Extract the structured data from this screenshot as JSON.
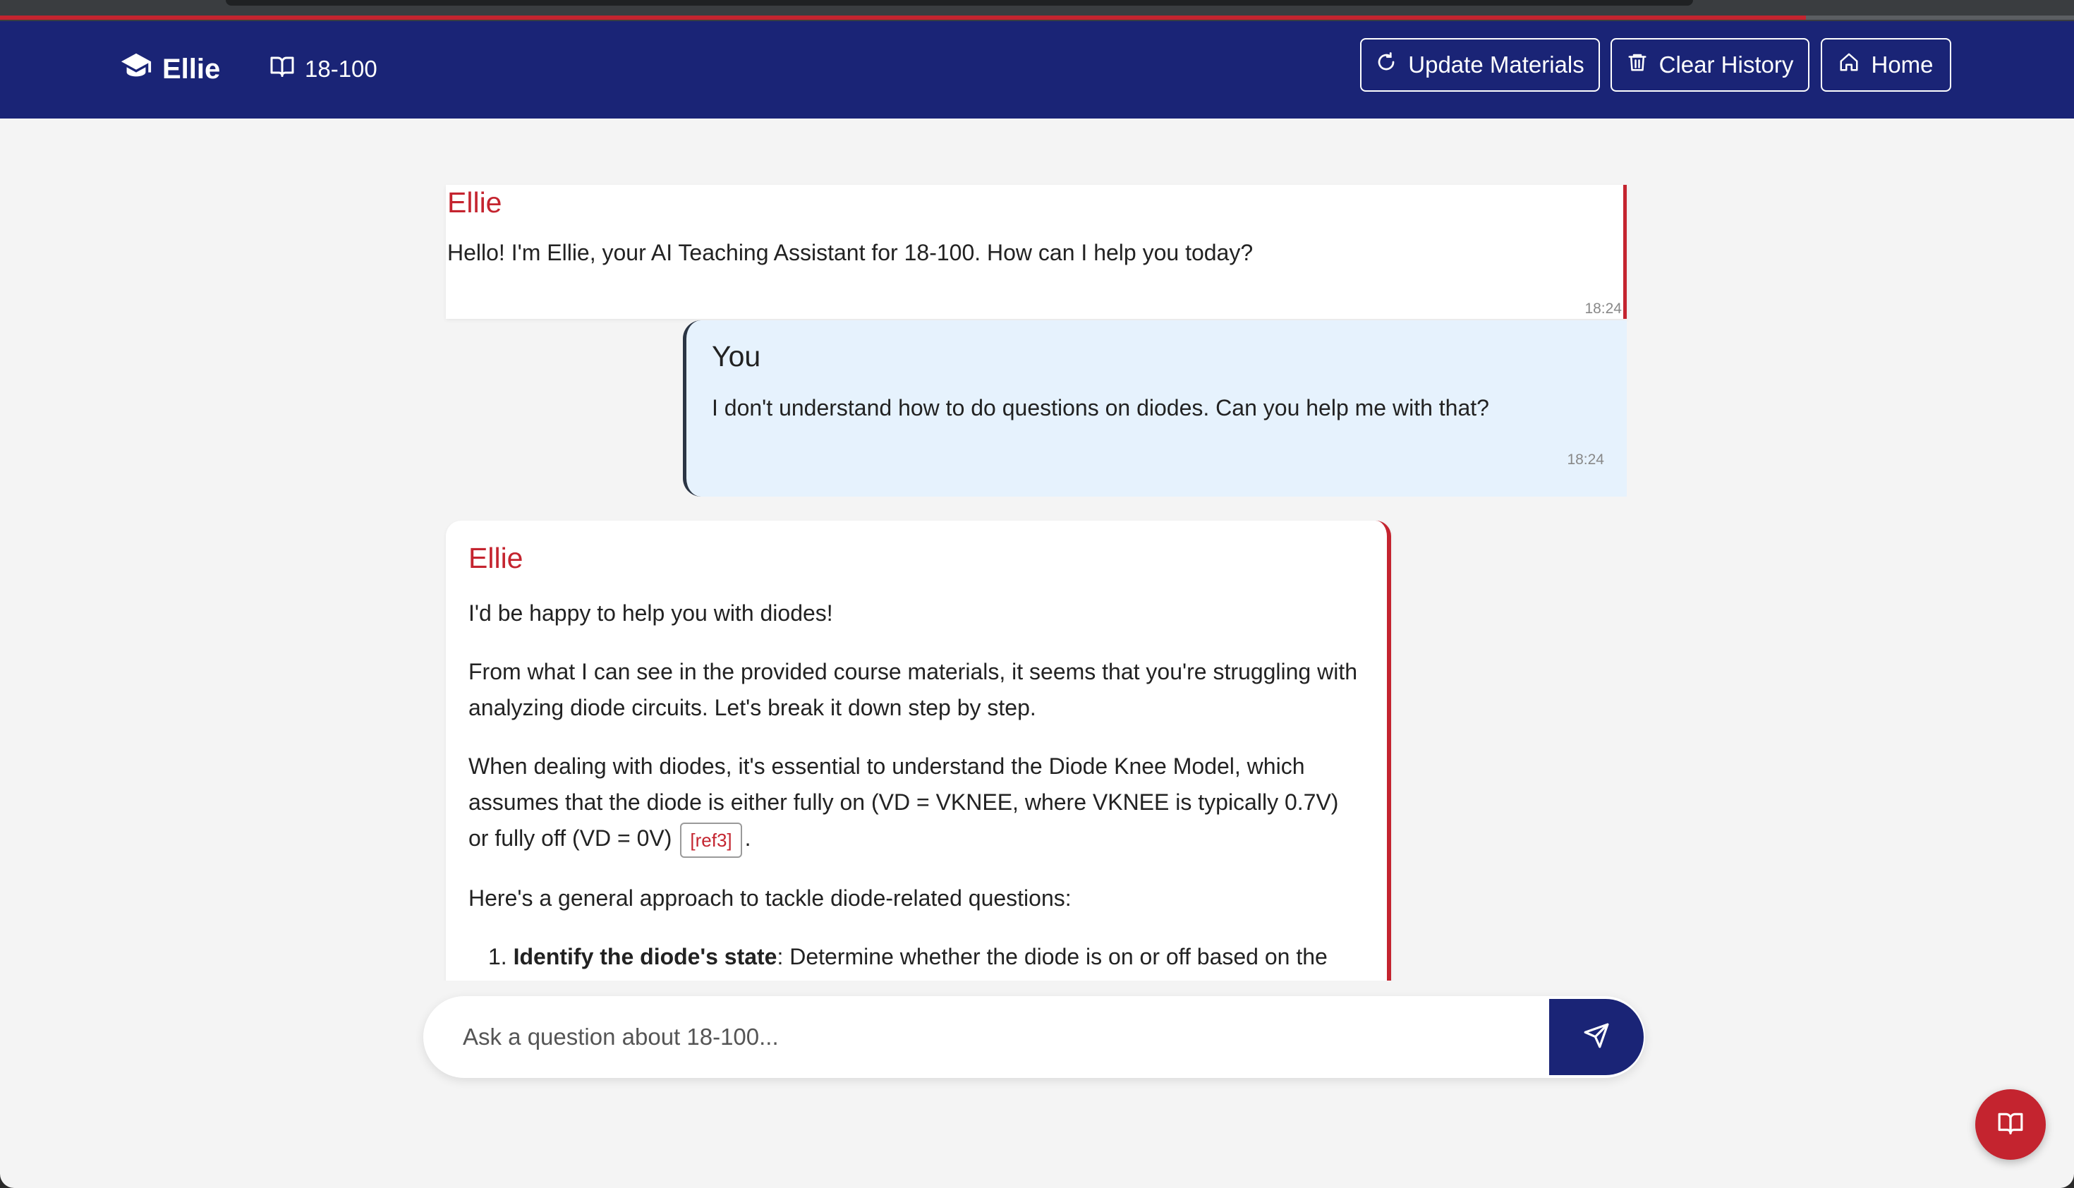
{
  "header": {
    "brand": "Ellie",
    "course": "18-100",
    "buttons": {
      "update": "Update Materials",
      "clear": "Clear History",
      "home": "Home"
    }
  },
  "messages": [
    {
      "sender": "Ellie",
      "text": "Hello! I'm Ellie, your AI Teaching Assistant for 18-100. How can I help you today?",
      "time": "18:24"
    },
    {
      "sender": "You",
      "text": "I don't understand how to do questions on diodes. Can you help me with that?",
      "time": "18:24"
    },
    {
      "sender": "Ellie",
      "paragraphs": [
        "I'd be happy to help you with diodes!",
        "From what I can see in the provided course materials, it seems that you're struggling with analyzing diode circuits. Let's break it down step by step.",
        "When dealing with diodes, it's essential to understand the Diode Knee Model, which assumes that the diode is either fully on (VD = VKNEE, where VKNEE is typically 0.7V) or fully off (VD = 0V)",
        "Here's a general approach to tackle diode-related questions:"
      ],
      "ref": "[ref3]",
      "ref_after": ".",
      "list": [
        {
          "num": "1.",
          "bold": "Identify the diode's state",
          "rest": ": Determine whether the diode is on or off based on the"
        }
      ]
    }
  ],
  "input": {
    "placeholder": "Ask a question about 18-100..."
  },
  "icons": {
    "brand": "graduation-cap-icon",
    "course": "book-icon",
    "update": "refresh-icon",
    "clear": "trash-icon",
    "home": "home-icon",
    "send": "send-icon",
    "fab": "book-icon"
  },
  "colors": {
    "navbar": "#1a2476",
    "accent": "#c4242f",
    "user_bubble": "#e6f2fd",
    "background": "#f4f4f4"
  }
}
